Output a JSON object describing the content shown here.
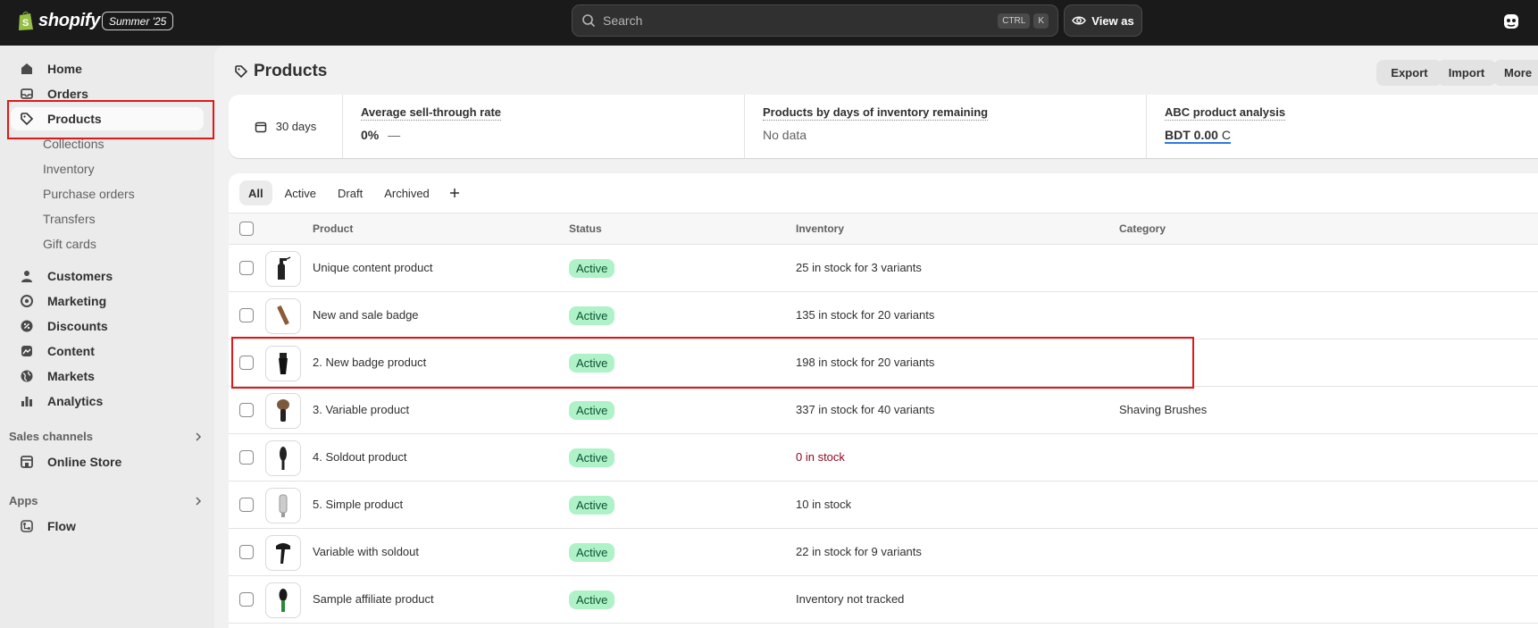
{
  "topbar": {
    "brand": "shopify",
    "season_badge": "Summer '25",
    "search": {
      "placeholder": "Search",
      "shortcut_1": "CTRL",
      "shortcut_2": "K"
    },
    "view_as": "View as"
  },
  "sidebar": {
    "main_items": [
      {
        "label": "Home",
        "icon": "home-icon"
      },
      {
        "label": "Orders",
        "icon": "inbox-icon"
      },
      {
        "label": "Products",
        "icon": "tag-icon",
        "selected": true
      }
    ],
    "product_sub_items": [
      "Collections",
      "Inventory",
      "Purchase orders",
      "Transfers",
      "Gift cards"
    ],
    "more_items": [
      {
        "label": "Customers",
        "icon": "person-icon"
      },
      {
        "label": "Marketing",
        "icon": "target-icon"
      },
      {
        "label": "Discounts",
        "icon": "discount-icon"
      },
      {
        "label": "Content",
        "icon": "content-icon"
      },
      {
        "label": "Markets",
        "icon": "globe-icon"
      },
      {
        "label": "Analytics",
        "icon": "chart-icon"
      }
    ],
    "sales_channels": {
      "label": "Sales channels",
      "items": [
        "Online Store"
      ]
    },
    "apps": {
      "label": "Apps",
      "items": [
        "Flow"
      ]
    }
  },
  "page": {
    "title": "Products",
    "actions": {
      "export": "Export",
      "import": "Import",
      "more": "More"
    }
  },
  "metrics": {
    "period": "30 days",
    "sell_through": {
      "title": "Average sell-through rate",
      "value": "0%",
      "trend": "—"
    },
    "days_inventory": {
      "title": "Products by days of inventory remaining",
      "value": "No data"
    },
    "abc": {
      "title": "ABC product analysis",
      "value": "BDT 0.00",
      "suffix": "C"
    }
  },
  "tabs": [
    "All",
    "Active",
    "Draft",
    "Archived"
  ],
  "table": {
    "headers": {
      "product": "Product",
      "status": "Status",
      "inventory": "Inventory",
      "category": "Category"
    },
    "rows": [
      {
        "name": "Unique content product",
        "status": "Active",
        "inventory": "25 in stock for 3 variants",
        "category": ""
      },
      {
        "name": "New and sale badge",
        "status": "Active",
        "inventory": "135 in stock for 20 variants",
        "category": ""
      },
      {
        "name": "2. New badge product",
        "status": "Active",
        "inventory": "198 in stock for 20 variants",
        "category": ""
      },
      {
        "name": "3. Variable product",
        "status": "Active",
        "inventory": "337 in stock for 40 variants",
        "category": "Shaving Brushes"
      },
      {
        "name": "4. Soldout product",
        "status": "Active",
        "inventory": "0 in stock",
        "category": ""
      },
      {
        "name": "5. Simple product",
        "status": "Active",
        "inventory": "10 in stock",
        "category": ""
      },
      {
        "name": "Variable with soldout",
        "status": "Active",
        "inventory": "22 in stock for 9 variants",
        "category": ""
      },
      {
        "name": "Sample affiliate product",
        "status": "Active",
        "inventory": "Inventory not tracked",
        "category": ""
      }
    ]
  },
  "colors": {
    "topbar": "#1a1a1a",
    "status_active_bg": "#aff2c8",
    "critical_text": "#8e0b21",
    "highlight": "#e01818"
  }
}
